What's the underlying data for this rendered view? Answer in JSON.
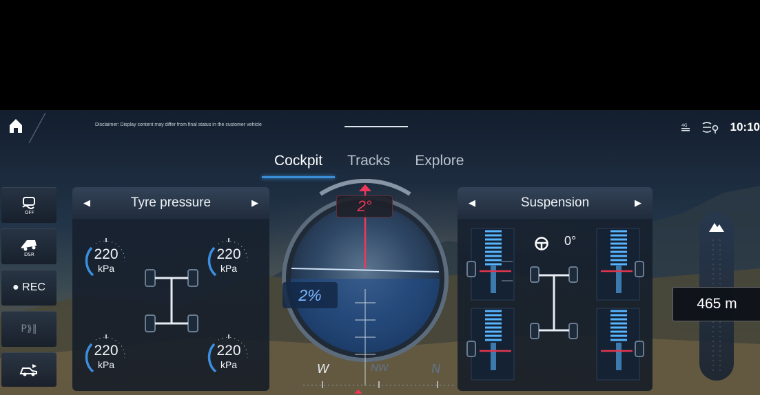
{
  "status_bar": {
    "disclaimer": "Disclaimer: Display content may differ from final status in the customer vehicle",
    "clock": "10:10",
    "icons": [
      "home-icon",
      "network-4g-icon",
      "drive-program-icon"
    ]
  },
  "tabs": [
    {
      "label": "Cockpit",
      "active": true
    },
    {
      "label": "Tracks",
      "active": false
    },
    {
      "label": "Explore",
      "active": false
    }
  ],
  "left_rail": {
    "items": [
      {
        "icon": "esp-off-icon"
      },
      {
        "icon": "downhill-speed-regulation-icon"
      },
      {
        "label": "REC"
      },
      {
        "label": "P"
      },
      {
        "icon": "camera-car-icon"
      }
    ]
  },
  "tyre_panel": {
    "title": "Tyre pressure",
    "front_left": {
      "value": "220",
      "unit": "kPa"
    },
    "front_right": {
      "value": "220",
      "unit": "kPa"
    },
    "rear_left": {
      "value": "220",
      "unit": "kPa"
    },
    "rear_right": {
      "value": "220",
      "unit": "kPa"
    }
  },
  "inclinometer": {
    "pitch": "2°",
    "roll": "2%",
    "compass": [
      "W",
      "NW",
      "N"
    ],
    "colors": {
      "pitch": "#f0365a",
      "roll": "#79b6ff"
    }
  },
  "suspension_panel": {
    "title": "Suspension",
    "steering_angle": "0°"
  },
  "altitude": {
    "value": "465 m",
    "icon": "mountain-icon"
  }
}
